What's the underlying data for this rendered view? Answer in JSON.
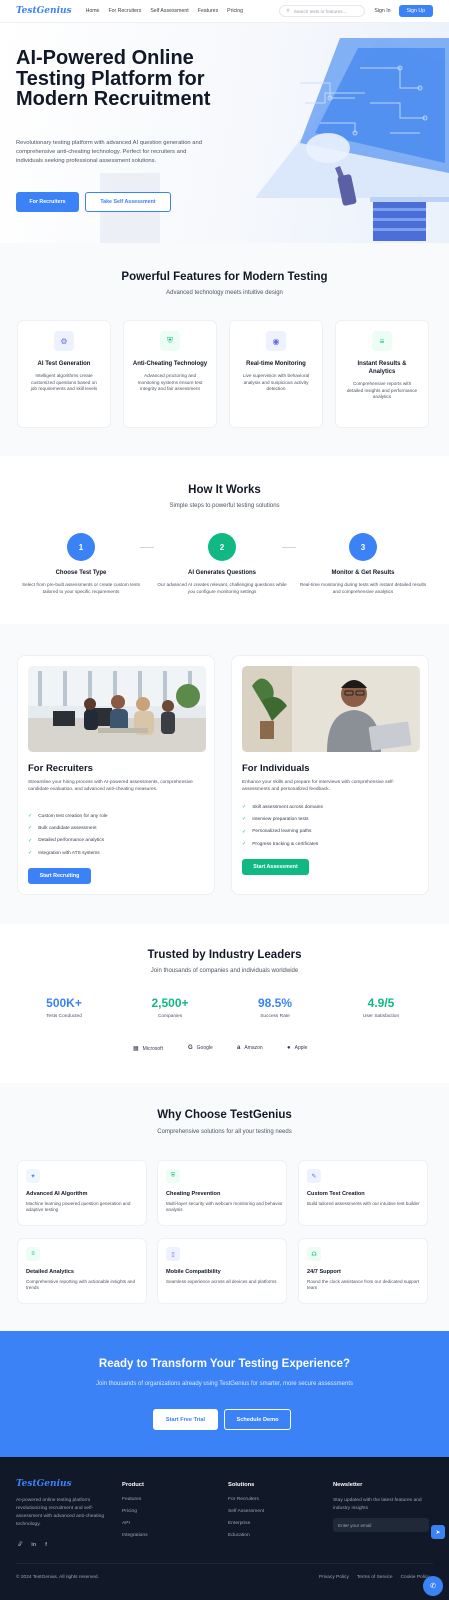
{
  "nav": {
    "logo": "TestGenius",
    "links": [
      "Home",
      "For Recruiters",
      "Self Assessment",
      "Features",
      "Pricing"
    ],
    "search_placeholder": "Search tests or features...",
    "signin": "Sign In",
    "signup": "Sign Up"
  },
  "hero": {
    "title": "AI-Powered Online Testing Platform for Modern Recruitment",
    "description": "Revolutionary testing platform with advanced AI question generation and comprehensive anti-cheating technology. Perfect for recruiters and individuals seeking professional assessment solutions.",
    "btn_recruiters": "For Recruiters",
    "btn_self": "Take Self Assessment"
  },
  "features": {
    "title": "Powerful Features for Modern Testing",
    "subtitle": "Advanced technology meets intuitive design",
    "items": [
      {
        "title": "AI Test Generation",
        "desc": "Intelligent algorithms create customized questions based on job requirements and skill levels",
        "icon": "gear-icon",
        "color": "#6366f1",
        "bg": "#eef2ff"
      },
      {
        "title": "Anti-Cheating Technology",
        "desc": "Advanced proctoring and monitoring systems ensure test integrity and fair assessment",
        "icon": "shield-icon",
        "color": "#10b981",
        "bg": "#ecfdf5"
      },
      {
        "title": "Real-time Monitoring",
        "desc": "Live supervision with behavioral analysis and suspicious activity detection",
        "icon": "eye-icon",
        "color": "#6366f1",
        "bg": "#eef2ff"
      },
      {
        "title": "Instant Results & Analytics",
        "desc": "Comprehensive reports with detailed insights and performance analytics",
        "icon": "chart-icon",
        "color": "#10b981",
        "bg": "#ecfdf5"
      }
    ]
  },
  "how": {
    "title": "How It Works",
    "subtitle": "Simple steps to powerful testing solutions",
    "steps": [
      {
        "num": "1",
        "title": "Choose Test Type",
        "desc": "Select from pre-built assessments or create custom tests tailored to your specific requirements",
        "color": "#3b82f6"
      },
      {
        "num": "2",
        "title": "AI Generates Questions",
        "desc": "Our advanced AI creates relevant, challenging questions while you configure monitoring settings",
        "color": "#10b981"
      },
      {
        "num": "3",
        "title": "Monitor & Get Results",
        "desc": "Real-time monitoring during tests with instant detailed results and comprehensive analytics",
        "color": "#3b82f6"
      }
    ]
  },
  "recruiters": {
    "title": "For Recruiters",
    "desc": "Streamline your hiring process with AI-powered assessments, comprehensive candidate evaluation, and advanced anti-cheating measures.",
    "items": [
      "Custom test creation for any role",
      "Bulk candidate assessment",
      "Detailed performance analytics",
      "Integration with ATS systems"
    ],
    "button": "Start Recruiting"
  },
  "individuals": {
    "title": "For Individuals",
    "desc": "Enhance your skills and prepare for interviews with comprehensive self-assessments and personalized feedback.",
    "items": [
      "Skill assessment across domains",
      "Interview preparation tests",
      "Personalized learning paths",
      "Progress tracking & certificates"
    ],
    "button": "Start Assessment"
  },
  "trusted": {
    "title": "Trusted by Industry Leaders",
    "subtitle": "Join thousands of companies and individuals worldwide",
    "stats": [
      {
        "value": "500K+",
        "label": "Tests Conducted",
        "color": "#3b82f6"
      },
      {
        "value": "2,500+",
        "label": "Companies",
        "color": "#10b981"
      },
      {
        "value": "98.5%",
        "label": "Success Rate",
        "color": "#3b82f6"
      },
      {
        "value": "4.9/5",
        "label": "User Satisfaction",
        "color": "#10b981"
      }
    ],
    "brands": [
      "Microsoft",
      "Google",
      "Amazon",
      "Apple"
    ]
  },
  "why": {
    "title": "Why Choose TestGenius",
    "subtitle": "Comprehensive solutions for all your testing needs",
    "items": [
      {
        "title": "Advanced AI Algorithm",
        "desc": "Machine learning powered question generation and adaptive testing",
        "icon": "brain-icon",
        "color": "#3b82f6",
        "bg": "#eff6ff"
      },
      {
        "title": "Cheating Prevention",
        "desc": "Multi-layer security with webcam monitoring and behavior analysis",
        "icon": "shield-icon",
        "color": "#10b981",
        "bg": "#ecfdf5"
      },
      {
        "title": "Custom Test Creation",
        "desc": "Build tailored assessments with our intuitive test builder",
        "icon": "pen-icon",
        "color": "#6366f1",
        "bg": "#eef2ff"
      },
      {
        "title": "Detailed Analytics",
        "desc": "Comprehensive reporting with actionable insights and trends",
        "icon": "chart-icon",
        "color": "#10b981",
        "bg": "#ecfdf5"
      },
      {
        "title": "Mobile Compatibility",
        "desc": "Seamless experience across all devices and platforms",
        "icon": "mobile-icon",
        "color": "#6366f1",
        "bg": "#eef2ff"
      },
      {
        "title": "24/7 Support",
        "desc": "Round the clock assistance from our dedicated support team",
        "icon": "headset-icon",
        "color": "#10b981",
        "bg": "#ecfdf5"
      }
    ]
  },
  "cta": {
    "title": "Ready to Transform Your Testing Experience?",
    "desc": "Join thousands of organizations already using TestGenius for smarter, more secure assessments",
    "btn_trial": "Start Free Trial",
    "btn_demo": "Schedule Demo"
  },
  "footer": {
    "logo": "TestGenius",
    "about": "AI-powered online testing platform revolutionizing recruitment and self-assessment with advanced anti-cheating technology.",
    "product_title": "Product",
    "product": [
      "Features",
      "Pricing",
      "API",
      "Integrations"
    ],
    "solutions_title": "Solutions",
    "solutions": [
      "For Recruiters",
      "Self Assessment",
      "Enterprise",
      "Education"
    ],
    "newsletter_title": "Newsletter",
    "newsletter_desc": "Stay updated with the latest features and industry insights",
    "email_placeholder": "Enter your email",
    "copyright": "© 2024 TestGenius. All rights reserved.",
    "legal": [
      "Privacy Policy",
      "Terms of Service",
      "Cookie Policy"
    ]
  }
}
